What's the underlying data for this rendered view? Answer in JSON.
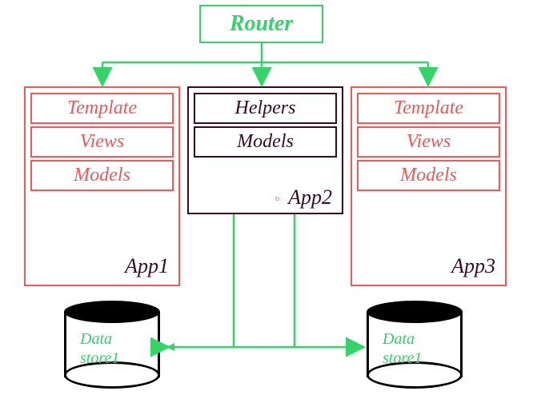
{
  "router": {
    "label": "Router"
  },
  "app1": {
    "label": "App1",
    "boxes": [
      "Template",
      "Views",
      "Models"
    ]
  },
  "app2": {
    "label": "App2",
    "boxes": [
      "Helpers",
      "Models"
    ],
    "marker": "o"
  },
  "app3": {
    "label": "App3",
    "boxes": [
      "Template",
      "Views",
      "Models"
    ]
  },
  "datastore1": {
    "line1": "Data",
    "line2": "store1"
  },
  "datastore2": {
    "line1": "Data",
    "line2": "store1"
  }
}
